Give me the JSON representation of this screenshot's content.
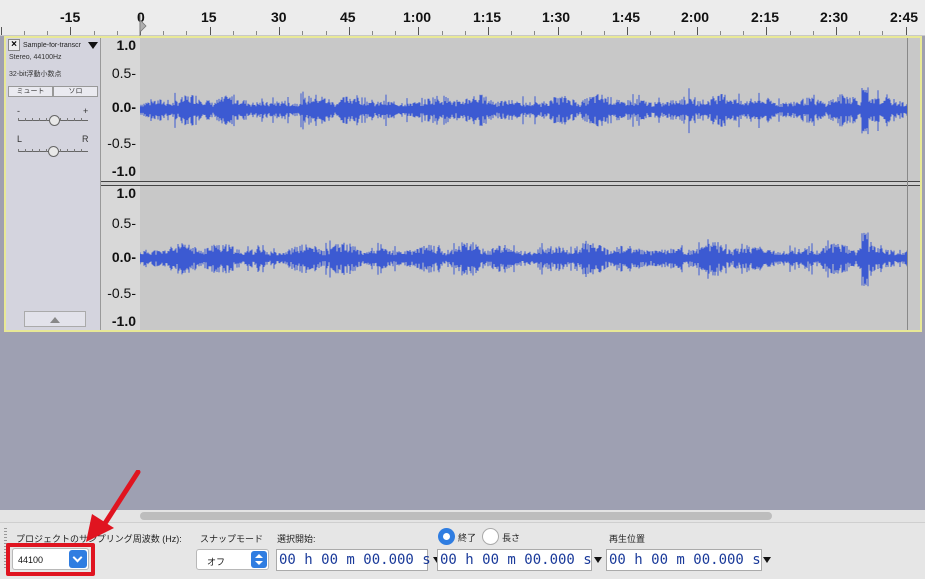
{
  "ruler": {
    "labels": [
      "-15",
      "0",
      "15",
      "30",
      "45",
      "1:00",
      "1:15",
      "1:30",
      "1:45",
      "2:00",
      "2:15",
      "2:30",
      "2:45"
    ]
  },
  "track": {
    "name": "Sample-for-transcr",
    "format": "Stereo, 44100Hz",
    "bit_depth": "32-bit浮動小数点",
    "mute_label": "ミュート",
    "solo_label": "ソロ",
    "gain_minus": "-",
    "gain_plus": "+",
    "pan_left": "L",
    "pan_right": "R",
    "gain_level": 0.52,
    "pan_level": 0.5,
    "wave_color": "#3c5ad2"
  },
  "vruler": {
    "labels": [
      "1.0",
      "0.5-",
      "0.0-",
      "-0.5-",
      "-1.0"
    ]
  },
  "toolbar": {
    "rate_label": "プロジェクトのサンプリング周波数 (Hz):",
    "rate_value": "44100",
    "snap_label": "スナップモード",
    "snap_value": "オフ",
    "sel_start_label": "選択開始:",
    "end_label": "終了",
    "length_label": "長さ",
    "play_pos_label": "再生位置",
    "end_selected": true,
    "time_start": "00 h 00 m 00.000 s",
    "time_end": "00 h 00 m 00.000 s",
    "time_play": "00 h 00 m 00.000 s",
    "accent_color": "#2f7de1",
    "highlight_color": "#e01420"
  }
}
